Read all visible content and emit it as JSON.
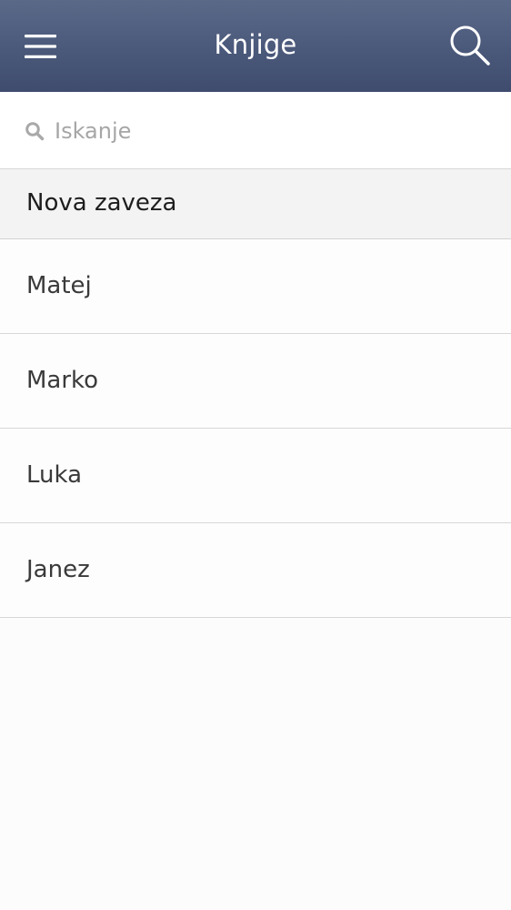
{
  "header": {
    "title": "Knjige",
    "menu_icon": "hamburger-menu-icon",
    "search_icon": "search-icon",
    "background_color": "#4a587a"
  },
  "search": {
    "placeholder": "Iskanje",
    "value": "",
    "icon": "search-icon"
  },
  "section": {
    "title": "Nova zaveza"
  },
  "books": [
    {
      "label": "Matej"
    },
    {
      "label": "Marko"
    },
    {
      "label": "Luka"
    },
    {
      "label": "Janez"
    }
  ]
}
